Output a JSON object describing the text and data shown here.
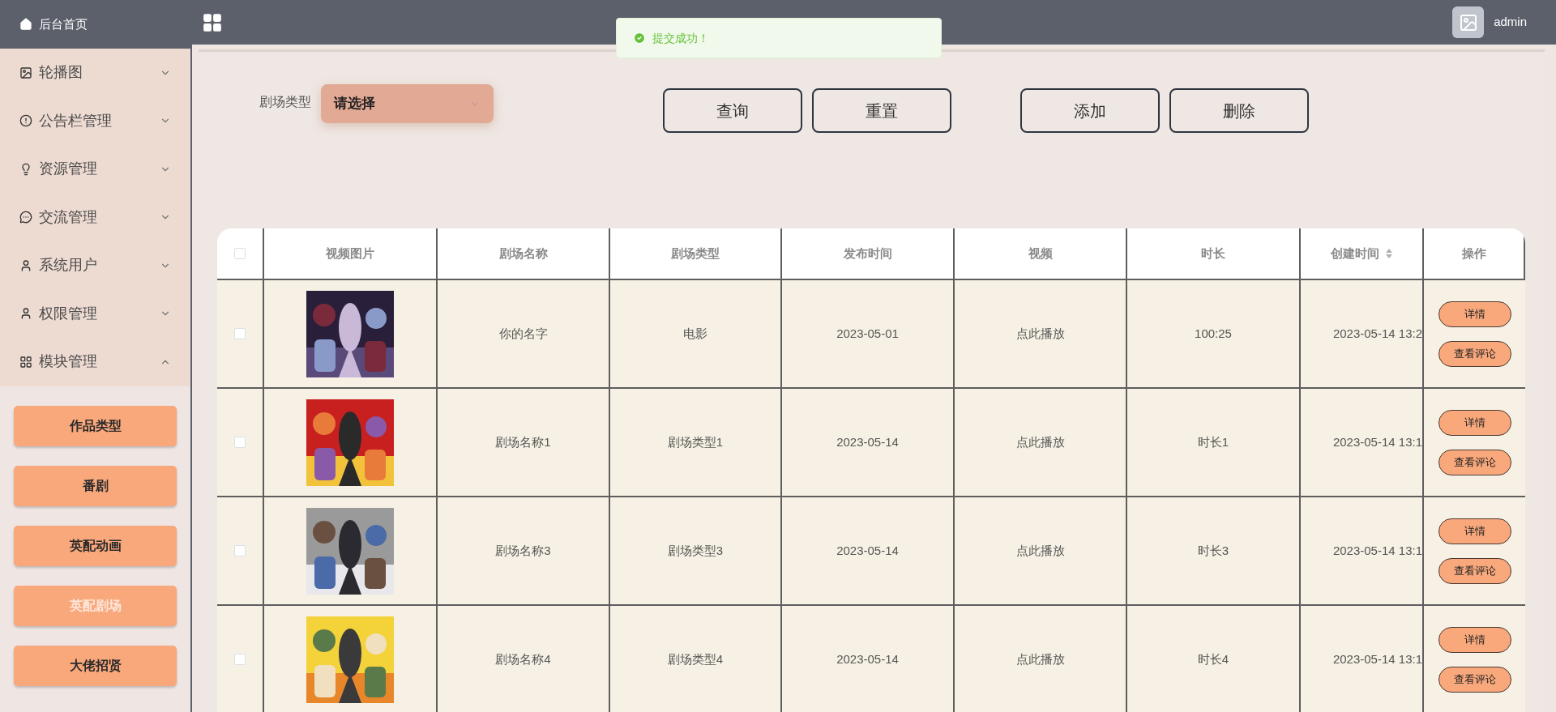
{
  "sidebar": {
    "home": "后台首页",
    "items": [
      {
        "label": "轮播图",
        "expanded": false
      },
      {
        "label": "公告栏管理",
        "expanded": false
      },
      {
        "label": "资源管理",
        "expanded": false
      },
      {
        "label": "交流管理",
        "expanded": false
      },
      {
        "label": "系统用户",
        "expanded": false
      },
      {
        "label": "权限管理",
        "expanded": false
      },
      {
        "label": "模块管理",
        "expanded": true,
        "children": [
          {
            "label": "作品类型",
            "selected": false
          },
          {
            "label": "番剧",
            "selected": false
          },
          {
            "label": "英配动画",
            "selected": false
          },
          {
            "label": "英配剧场",
            "selected": true
          },
          {
            "label": "大佬招贤",
            "selected": false
          }
        ]
      }
    ]
  },
  "header": {
    "user": "admin"
  },
  "toast": {
    "message": "提交成功！"
  },
  "filter": {
    "label": "剧场类型",
    "select": {
      "placeholder": "请选择"
    }
  },
  "buttons": [
    "查询",
    "重置",
    "添加",
    "删除"
  ],
  "table": {
    "select_all": {
      "checked": false
    },
    "columns": [
      {
        "label": "视频图片",
        "sortable": false
      },
      {
        "label": "剧场名称",
        "sortable": false
      },
      {
        "label": "剧场类型",
        "sortable": false
      },
      {
        "label": "发布时间",
        "sortable": false
      },
      {
        "label": "视频",
        "sortable": false
      },
      {
        "label": "时长",
        "sortable": false
      },
      {
        "label": "创建时间",
        "sortable": true
      },
      {
        "label": "操作",
        "sortable": false
      }
    ],
    "rows": [
      {
        "checked": false,
        "name": "你的名字",
        "type": "电影",
        "published": "2023-05-01",
        "video": "点此播放",
        "duration": "100:25",
        "created": "2023-05-14 13:2",
        "actions": [
          "详情",
          "查看评论"
        ]
      },
      {
        "checked": false,
        "name": "剧场名称1",
        "type": "剧场类型1",
        "published": "2023-05-14",
        "video": "点此播放",
        "duration": "时长1",
        "created": "2023-05-14 13:1",
        "actions": [
          "详情",
          "查看评论"
        ]
      },
      {
        "checked": false,
        "name": "剧场名称3",
        "type": "剧场类型3",
        "published": "2023-05-14",
        "video": "点此播放",
        "duration": "时长3",
        "created": "2023-05-14 13:1",
        "actions": [
          "详情",
          "查看评论"
        ]
      },
      {
        "checked": false,
        "name": "剧场名称4",
        "type": "剧场类型4",
        "published": "2023-05-14",
        "video": "点此播放",
        "duration": "时长4",
        "created": "2023-05-14 13:1",
        "actions": [
          "详情",
          "查看评论"
        ]
      }
    ]
  }
}
